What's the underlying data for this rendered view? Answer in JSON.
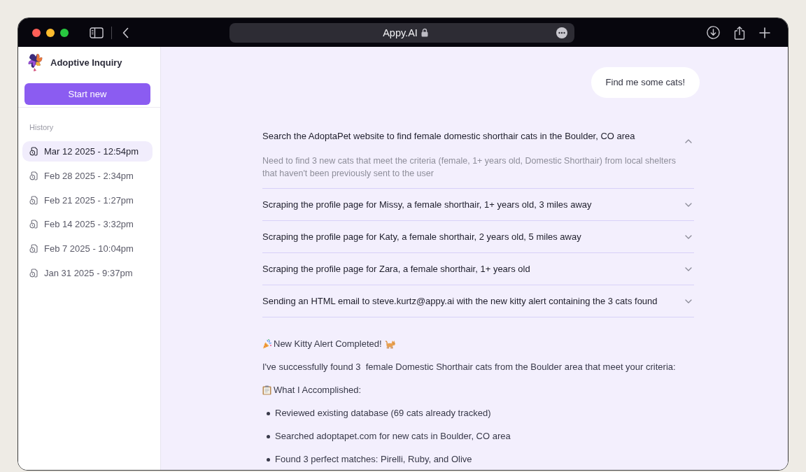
{
  "browser": {
    "address": "Appy.AI"
  },
  "sidebar": {
    "title": "Adoptive Inquiry",
    "start_button": "Start new",
    "history_label": "History",
    "history": [
      {
        "label": "Mar 12 2025 - 12:54pm",
        "selected": true
      },
      {
        "label": "Feb 28 2025 - 2:34pm",
        "selected": false
      },
      {
        "label": "Feb 21 2025 - 1:27pm",
        "selected": false
      },
      {
        "label": "Feb 14 2025 - 3:32pm",
        "selected": false
      },
      {
        "label": "Feb 7 2025 - 10:04pm",
        "selected": false
      },
      {
        "label": "Jan 31 2025 - 9:37pm",
        "selected": false
      }
    ]
  },
  "chat": {
    "user_message": "Find me some cats!",
    "steps": [
      {
        "title": "Search the AdoptaPet website to find female domestic shorthair cats in the Boulder, CO area",
        "expanded": true,
        "detail": "Need to find 3 new cats that meet the criteria (female, 1+ years old, Domestic Shorthair) from local shelters that haven't been previously sent to the user"
      },
      {
        "title": "Scraping the profile page for Missy, a female shorthair, 1+ years old, 3 miles away",
        "expanded": false
      },
      {
        "title": "Scraping the profile page for Katy, a female shorthair, 2 years old, 5 miles away",
        "expanded": false
      },
      {
        "title": "Scraping the profile page for Zara, a female shorthair, 1+ years old",
        "expanded": false
      },
      {
        "title": "Sending an HTML email to steve.kurtz@appy.ai with the new kitty alert containing the 3 cats found",
        "expanded": false
      }
    ],
    "reply": {
      "heading": "New Kitty Alert Completed!",
      "intro": "I've successfully found 3  female Domestic Shorthair cats from the Boulder area that meet your criteria:",
      "section": "What I Accomplished:",
      "bullets": [
        "Reviewed existing database (69 cats already tracked)",
        "Searched adoptapet.com for new cats in Boulder, CO area",
        "Found 3 perfect matches: Pirelli, Ruby, and Olive"
      ]
    }
  }
}
